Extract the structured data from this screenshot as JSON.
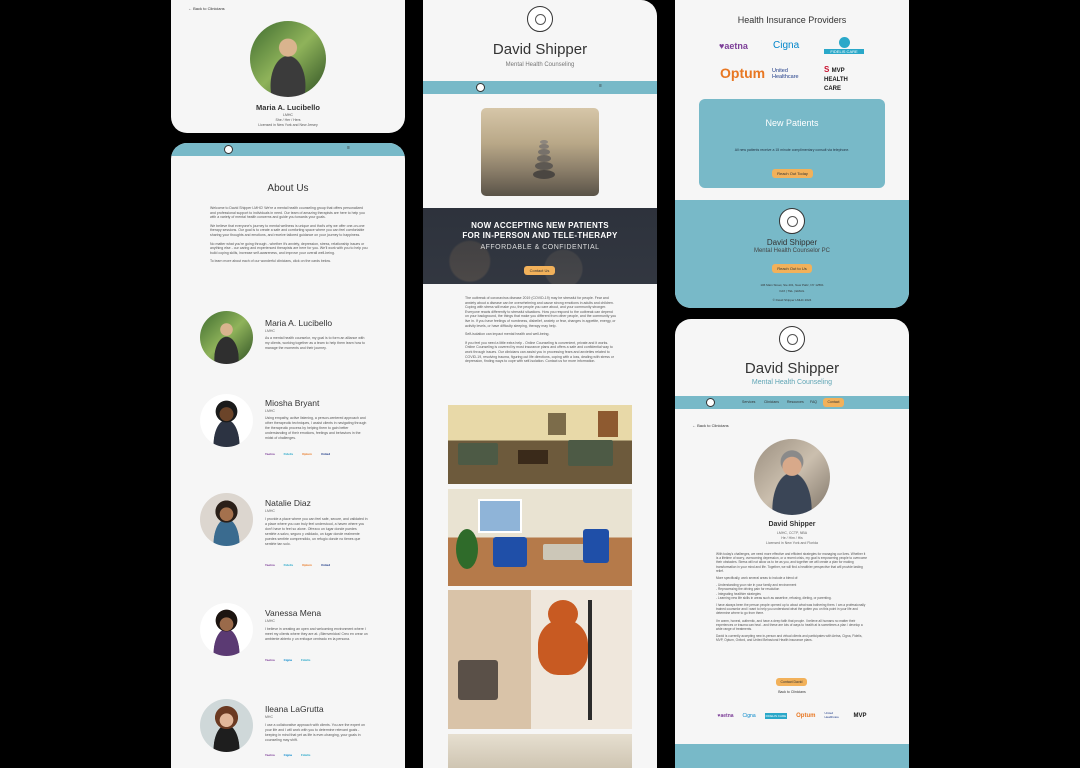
{
  "colors": {
    "teal": "#78b9c8",
    "orange": "#f2b15a",
    "page": "#f6f6f6",
    "aetna": "#7d3f98",
    "optum": "#e87722",
    "cigna": "#0085ca"
  },
  "profile_top": {
    "back_link": "← Back to Clinicians",
    "name": "Maria A. Lucibello",
    "credential": "LMHC",
    "meta": "She / Her / Hers",
    "license": "Licensed in New York and New Jersey"
  },
  "about": {
    "title": "About Us",
    "paragraphs": [
      "Welcome to David Shipper LMHC! We're a mental health counseling group that offers personalized and professional support to individuals in need. Our team of amazing therapists are here to help you with a variety of mental health concerns and guide you towards your goals.",
      "We believe that everyone's journey to mental wellness is unique and that's why we offer one-on-one therapy sessions. Our goal is to create a safe and comforting space where you can feel comfortable sharing your thoughts and emotions, and receive tailored guidance on your journey to happiness.",
      "No matter what you're going through - whether it's anxiety, depression, stress, relationship issues or anything else - our caring and experienced therapists are here for you. We'll work with you to help you build coping skills, increase self-awareness, and improve your overall well-being.",
      "To learn more about each of our wonderful clinicians, click on the cards below."
    ],
    "therapists": [
      {
        "name": "Maria A. Lucibello",
        "cred": "LMHC",
        "bio": "As a mental health counselor, my goal is to form an alliance with my clients, working together as a team to help them learn how to manage the moments and their journey.",
        "logos": []
      },
      {
        "name": "Miosha Bryant",
        "cred": "LMHC",
        "bio": "Using empathy, active listening, a person-centered approach and other therapeutic techniques, I assist clients in navigating through the therapeutic process by helping them to gain better understanding of their emotions, feelings and behaviors in the midst of challenges.",
        "logos": [
          "♥aetna",
          "Fidelis",
          "Optum",
          "United"
        ]
      },
      {
        "name": "Natalie Diaz",
        "cred": "LMHC",
        "bio": "I provide a place where you can feel safe, secure, and validated in a place where you can truly feel understood, a haven where you don't have to feel so alone. Ofrezco un lugar donde puedes sentirte a salvo, seguro y validado, un lugar donde realmente puedes sentirte comprendido, un refugio donde no tienes que sentirte tan solo.",
        "logos": [
          "♥aetna",
          "Fidelis",
          "Optum",
          "United"
        ]
      },
      {
        "name": "Vanessa Mena",
        "cred": "LMHC",
        "bio": "I believe in creating an open and welcoming environment where I meet my clients where they are at. ¡Bienvenidos! Creo en crear un ambiente abierto y un enfoque centrado en la persona.",
        "logos": [
          "♥aetna",
          "Cigna",
          "Fidelis"
        ]
      },
      {
        "name": "Ileana LaGrutta",
        "cred": "MHC",
        "bio": "I use a collaborative approach with clients. You are the expert on your life and I will work with you to determine relevant goals - keeping in mind that yet as life is ever-changing, your goals in counseling may shift.",
        "logos": [
          "♥aetna",
          "Cigna",
          "Fidelis"
        ]
      }
    ]
  },
  "home": {
    "brand_name": "David Shipper",
    "brand_sub": "Mental Health Counseling",
    "banner_line1": "NOW ACCEPTING NEW PATIENTS",
    "banner_line2": "FOR IN-PERSON AND TELE-THERAPY",
    "banner_line3": "AFFORDABLE & CONFIDENTIAL",
    "banner_button": "Contact Us",
    "covid_paragraphs": [
      "The outbreak of coronavirus disease 2019 (COVID-19) may be stressful for people. Fear and anxiety about a disease can be overwhelming and cause strong emotions in adults and children. Coping with stress will make you, the people you care about, and your community stronger. Everyone reacts differently to stressful situations. How you respond to the outbreak can depend on your background, the things that make you different from other people, and the community you live in. If you have feelings of numbness, disbelief, anxiety or fear, changes in appetite, energy, or activity levels, or have difficulty sleeping, therapy may help.",
      "Self-isolation can impact mental health and well-being.",
      "If you feel you need a little extra help - Online Counseling is convenient, private and it works. Online Counseling is covered by most insurance plans and offers a safe and confidential way to work through issues. Our clinicians can assist you in processing fears and anxieties related to COVID-19, resolving trauma, figuring out life directions, coping with a loss, dealing with stress or depression, finding ways to cope with self-isolation. Contact us for more information."
    ]
  },
  "insurance": {
    "title": "Health Insurance Providers",
    "logos": [
      "♥aetna",
      "Cigna",
      "FIDELIS CARE",
      "Optum",
      "United Healthcare",
      "MVP HEALTH CARE"
    ],
    "new_patients_title": "New Patients",
    "new_patients_text": "All new patients receive a 15 minute complimentary consult via telephone.",
    "new_patients_button": "Reach Out Today",
    "footer_name": "David Shipper",
    "footer_sub": "Mental Health Counselor PC",
    "footer_button": "Reach Out to Us",
    "footer_address": "106 Main Street, Ste 201, New Paltz, NY 12561",
    "footer_fax": "FAX | TEL | EMAIL",
    "footer_copy": "© David Shipper LMHC 2024"
  },
  "profile_david": {
    "brand_name": "David Shipper",
    "brand_sub": "Mental Health Counseling",
    "nav": [
      "Services",
      "Clinicians",
      "Resources",
      "FAQ",
      "Contact"
    ],
    "back_link": "← Back to Clinicians",
    "name": "David Shipper",
    "credential": "LMHC, CCTP, NBA",
    "meta": "He / Him / His",
    "license": "Licensed in New York and Florida",
    "bio": [
      "With today's challenges, we need more effective and efficient strategies for managing our lives. Whether it is a lifetime of worry, overcoming depression, or a recent crisis, my goal is empowering people to overcome their obstacles. Stress will not allow us to be as you, and together we will create a plan for making transformation in your mind and life. Together, we will find a healthier perspective that will provide lasting relief.",
      "More specifically, work several areas to include a blend of:",
      "- Understanding your role in your family and environment\n- Reprocessing the driving pain for resolution\n- Integrating healthier strategies\n- Learning new life skills in areas such as assertive, refusing, dieting, or parenting.",
      "I have always been the person people opened up to about what was bothering them. I am a professionally trained counselor and I want to help you understand what the gotten you on this point in your life and determine where to go from there.",
      "I'm warm, honest, authentic, and have a deep faith that people. I believe all humans no matter their experiences or trauma can heal - and these are lots of ways to health at is sometimes a plan / develop a wide range of treatments.",
      "David is currently accepting new in-person and virtual clients and participates with Aetna, Cigna, Fidelis, MVP, Optum, Oxford, and United Behavioral Health insurance plans."
    ],
    "contact_button": "Contact David",
    "back_button": "Back to Clinicians",
    "logos": [
      "♥aetna",
      "Cigna",
      "FIDELIS CARE",
      "Optum",
      "United Healthcare",
      "MVP"
    ]
  }
}
